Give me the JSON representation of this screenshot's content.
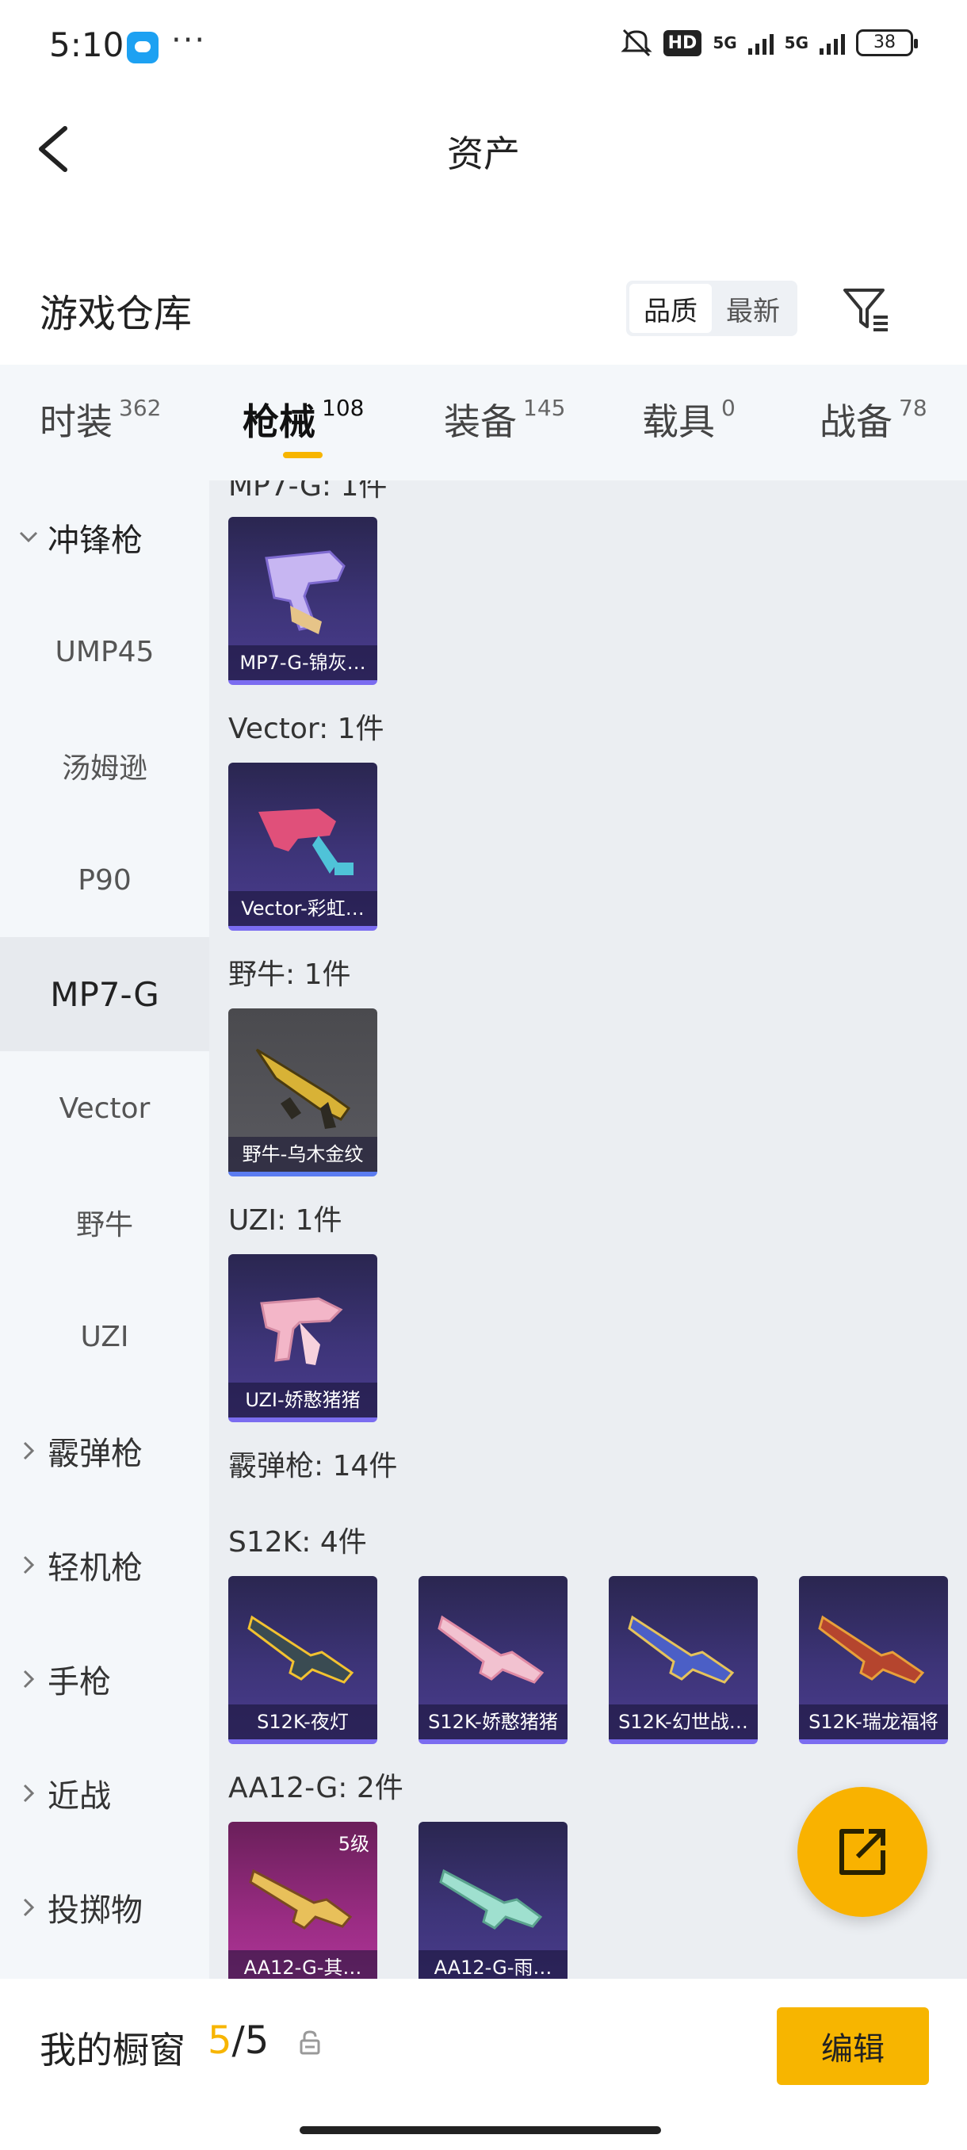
{
  "status_bar": {
    "time": "5:10",
    "dots": "···",
    "hd": "HD",
    "net1": "5G",
    "net2": "5G",
    "battery": "38"
  },
  "header": {
    "title": "资产"
  },
  "subheader": {
    "title": "游戏仓库",
    "sort_options": [
      "品质",
      "最新"
    ],
    "active_sort": "品质"
  },
  "tabs": [
    {
      "label": "时装",
      "count": "362"
    },
    {
      "label": "枪械",
      "count": "108"
    },
    {
      "label": "装备",
      "count": "145"
    },
    {
      "label": "载具",
      "count": "0"
    },
    {
      "label": "战备",
      "count": "78"
    }
  ],
  "active_tab": "枪械",
  "sidebar": {
    "group_open": "冲锋枪",
    "items": [
      "UMP45",
      "汤姆逊",
      "P90",
      "MP7-G",
      "Vector",
      "野牛",
      "UZI"
    ],
    "selected": "MP7-G",
    "groups": [
      "霰弹枪",
      "轻机枪",
      "手枪",
      "近战",
      "投掷物"
    ]
  },
  "content": {
    "partial_title": "MP7-G: 1件",
    "sections": [
      {
        "title": "MP7-G: 1件",
        "cards": [
          "MP7-G-锦灰…"
        ]
      },
      {
        "title": "Vector: 1件",
        "cards": [
          "Vector-彩虹…"
        ]
      },
      {
        "title": "野牛: 1件",
        "cards": [
          "野牛-乌木金纹"
        ]
      },
      {
        "title": "UZI: 1件",
        "cards": [
          "UZI-娇憨猪猪"
        ]
      }
    ],
    "category_title": "霰弹枪: 14件",
    "s12k": {
      "title": "S12K: 4件",
      "cards": [
        "S12K-夜灯",
        "S12K-娇憨猪猪",
        "S12K-幻世战…",
        "S12K-瑞龙福将"
      ]
    },
    "aa12": {
      "title": "AA12-G: 2件",
      "cards": [
        "AA12-G-其…",
        "AA12-G-雨…"
      ],
      "level": "5级"
    }
  },
  "bottom": {
    "label": "我的橱窗",
    "current": "5",
    "separator": "/",
    "total": "5",
    "edit_label": "编辑"
  },
  "colors": {
    "accent": "#f7b500",
    "card_purple": "#3d3478",
    "card_border": "#7b6cf0"
  },
  "icons": [
    "back-arrow-icon",
    "filter-icon",
    "share-icon",
    "lock-icon",
    "chevron-down-icon",
    "chevron-right-icon"
  ]
}
